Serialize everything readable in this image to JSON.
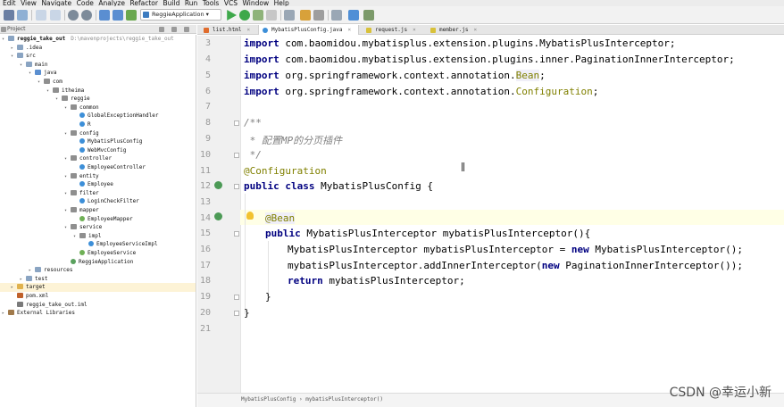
{
  "menubar": {
    "items": [
      "Edit",
      "View",
      "Navigate",
      "Code",
      "Analyze",
      "Refactor",
      "Build",
      "Run",
      "Tools",
      "VCS",
      "Window",
      "Help"
    ]
  },
  "toolbar": {
    "run_config": "ReggieApplication"
  },
  "project_panel": {
    "label": "Project",
    "tree": [
      {
        "label": "reggie_take_out",
        "path": "D:\\mavenprojects\\reggie_take_out",
        "icon": "folder-icon"
      },
      {
        "label": ".idea",
        "icon": "folder-icon"
      },
      {
        "label": "src",
        "icon": "folder-icon"
      },
      {
        "label": "main",
        "icon": "folder-icon"
      },
      {
        "label": "java",
        "icon": "folder-icon"
      },
      {
        "label": "com",
        "icon": "package-icon"
      },
      {
        "label": "itheima",
        "icon": "package-icon"
      },
      {
        "label": "reggie",
        "icon": "package-icon"
      },
      {
        "label": "common",
        "icon": "package-icon"
      },
      {
        "label": "GlobalExceptionHandler",
        "icon": "class-icon"
      },
      {
        "label": "R",
        "icon": "class-icon"
      },
      {
        "label": "config",
        "icon": "package-icon"
      },
      {
        "label": "MybatisPlusConfig",
        "icon": "class-icon"
      },
      {
        "label": "WebMvcConfig",
        "icon": "class-icon"
      },
      {
        "label": "controller",
        "icon": "package-icon"
      },
      {
        "label": "EmployeeController",
        "icon": "class-icon"
      },
      {
        "label": "entity",
        "icon": "package-icon"
      },
      {
        "label": "Employee",
        "icon": "class-icon"
      },
      {
        "label": "filter",
        "icon": "package-icon"
      },
      {
        "label": "LoginCheckFilter",
        "icon": "class-icon"
      },
      {
        "label": "mapper",
        "icon": "package-icon"
      },
      {
        "label": "EmployeeMapper",
        "icon": "interface-icon"
      },
      {
        "label": "service",
        "icon": "package-icon"
      },
      {
        "label": "impl",
        "icon": "package-icon"
      },
      {
        "label": "EmployeeServiceImpl",
        "icon": "class-icon"
      },
      {
        "label": "EmployeeService",
        "icon": "interface-icon"
      },
      {
        "label": "ReggieApplication",
        "icon": "class-icon"
      },
      {
        "label": "resources",
        "icon": "folder-icon"
      },
      {
        "label": "test",
        "icon": "folder-icon"
      },
      {
        "label": "target",
        "icon": "folder-icon"
      },
      {
        "label": "pom.xml",
        "icon": "maven-file-icon"
      },
      {
        "label": "reggie_take_out.iml",
        "icon": "iml-file-icon"
      },
      {
        "label": "External Libraries",
        "icon": "library-icon"
      }
    ]
  },
  "editor_tabs": [
    {
      "label": "list.html",
      "icon": "html-file-icon"
    },
    {
      "label": "MybatisPlusConfig.java",
      "icon": "class-icon",
      "active": true
    },
    {
      "label": "request.js",
      "icon": "js-file-icon"
    },
    {
      "label": "member.js",
      "icon": "js-file-icon"
    }
  ],
  "editor": {
    "line_numbers": [
      "3",
      "4",
      "5",
      "6",
      "7",
      "8",
      "9",
      "10",
      "11",
      "12",
      "13",
      "14",
      "15",
      "16",
      "17",
      "18",
      "19",
      "20",
      "21"
    ],
    "lines": {
      "l3": "com.baomidou.mybatisplus.extension.plugins.MybatisPlusInterceptor;",
      "l4": "com.baomidou.mybatisplus.extension.plugins.inner.PaginationInnerInterceptor;",
      "l5a": "org.springframework.context.annotation.",
      "l5b": "Bean",
      "l6a": "org.springframework.context.annotation.",
      "l6b": "Configuration",
      "kw_import": "import",
      "l8": "/**",
      "l9": " * 配置MP的分页插件",
      "l10": " */",
      "l11": "@Configuration",
      "l12_kw": "public class",
      "l12": " MybatisPlusConfig {",
      "l14": "@Bean",
      "l15_kw": "public",
      "l15": " MybatisPlusInterceptor mybatisPlusInterceptor(){",
      "l16a": "MybatisPlusInterceptor mybatisPlusInterceptor = ",
      "l16_kw": "new",
      "l16b": " MybatisPlusInterceptor();",
      "l17a": "mybatisPlusInterceptor.addInnerInterceptor(",
      "l17_kw": "new",
      "l17b": " PaginationInnerInterceptor());",
      "l18_kw": "return",
      "l18": " mybatisPlusInterceptor;",
      "l19": "}",
      "l20": "}",
      "semi": ";"
    }
  },
  "breadcrumb": "MybatisPlusConfig › mybatisPlusInterceptor()",
  "watermark": "CSDN @幸运小新",
  "colors": {
    "keyword": "#000080",
    "annotation": "#808000",
    "comment": "#808080",
    "current_line": "#ffffe6"
  }
}
